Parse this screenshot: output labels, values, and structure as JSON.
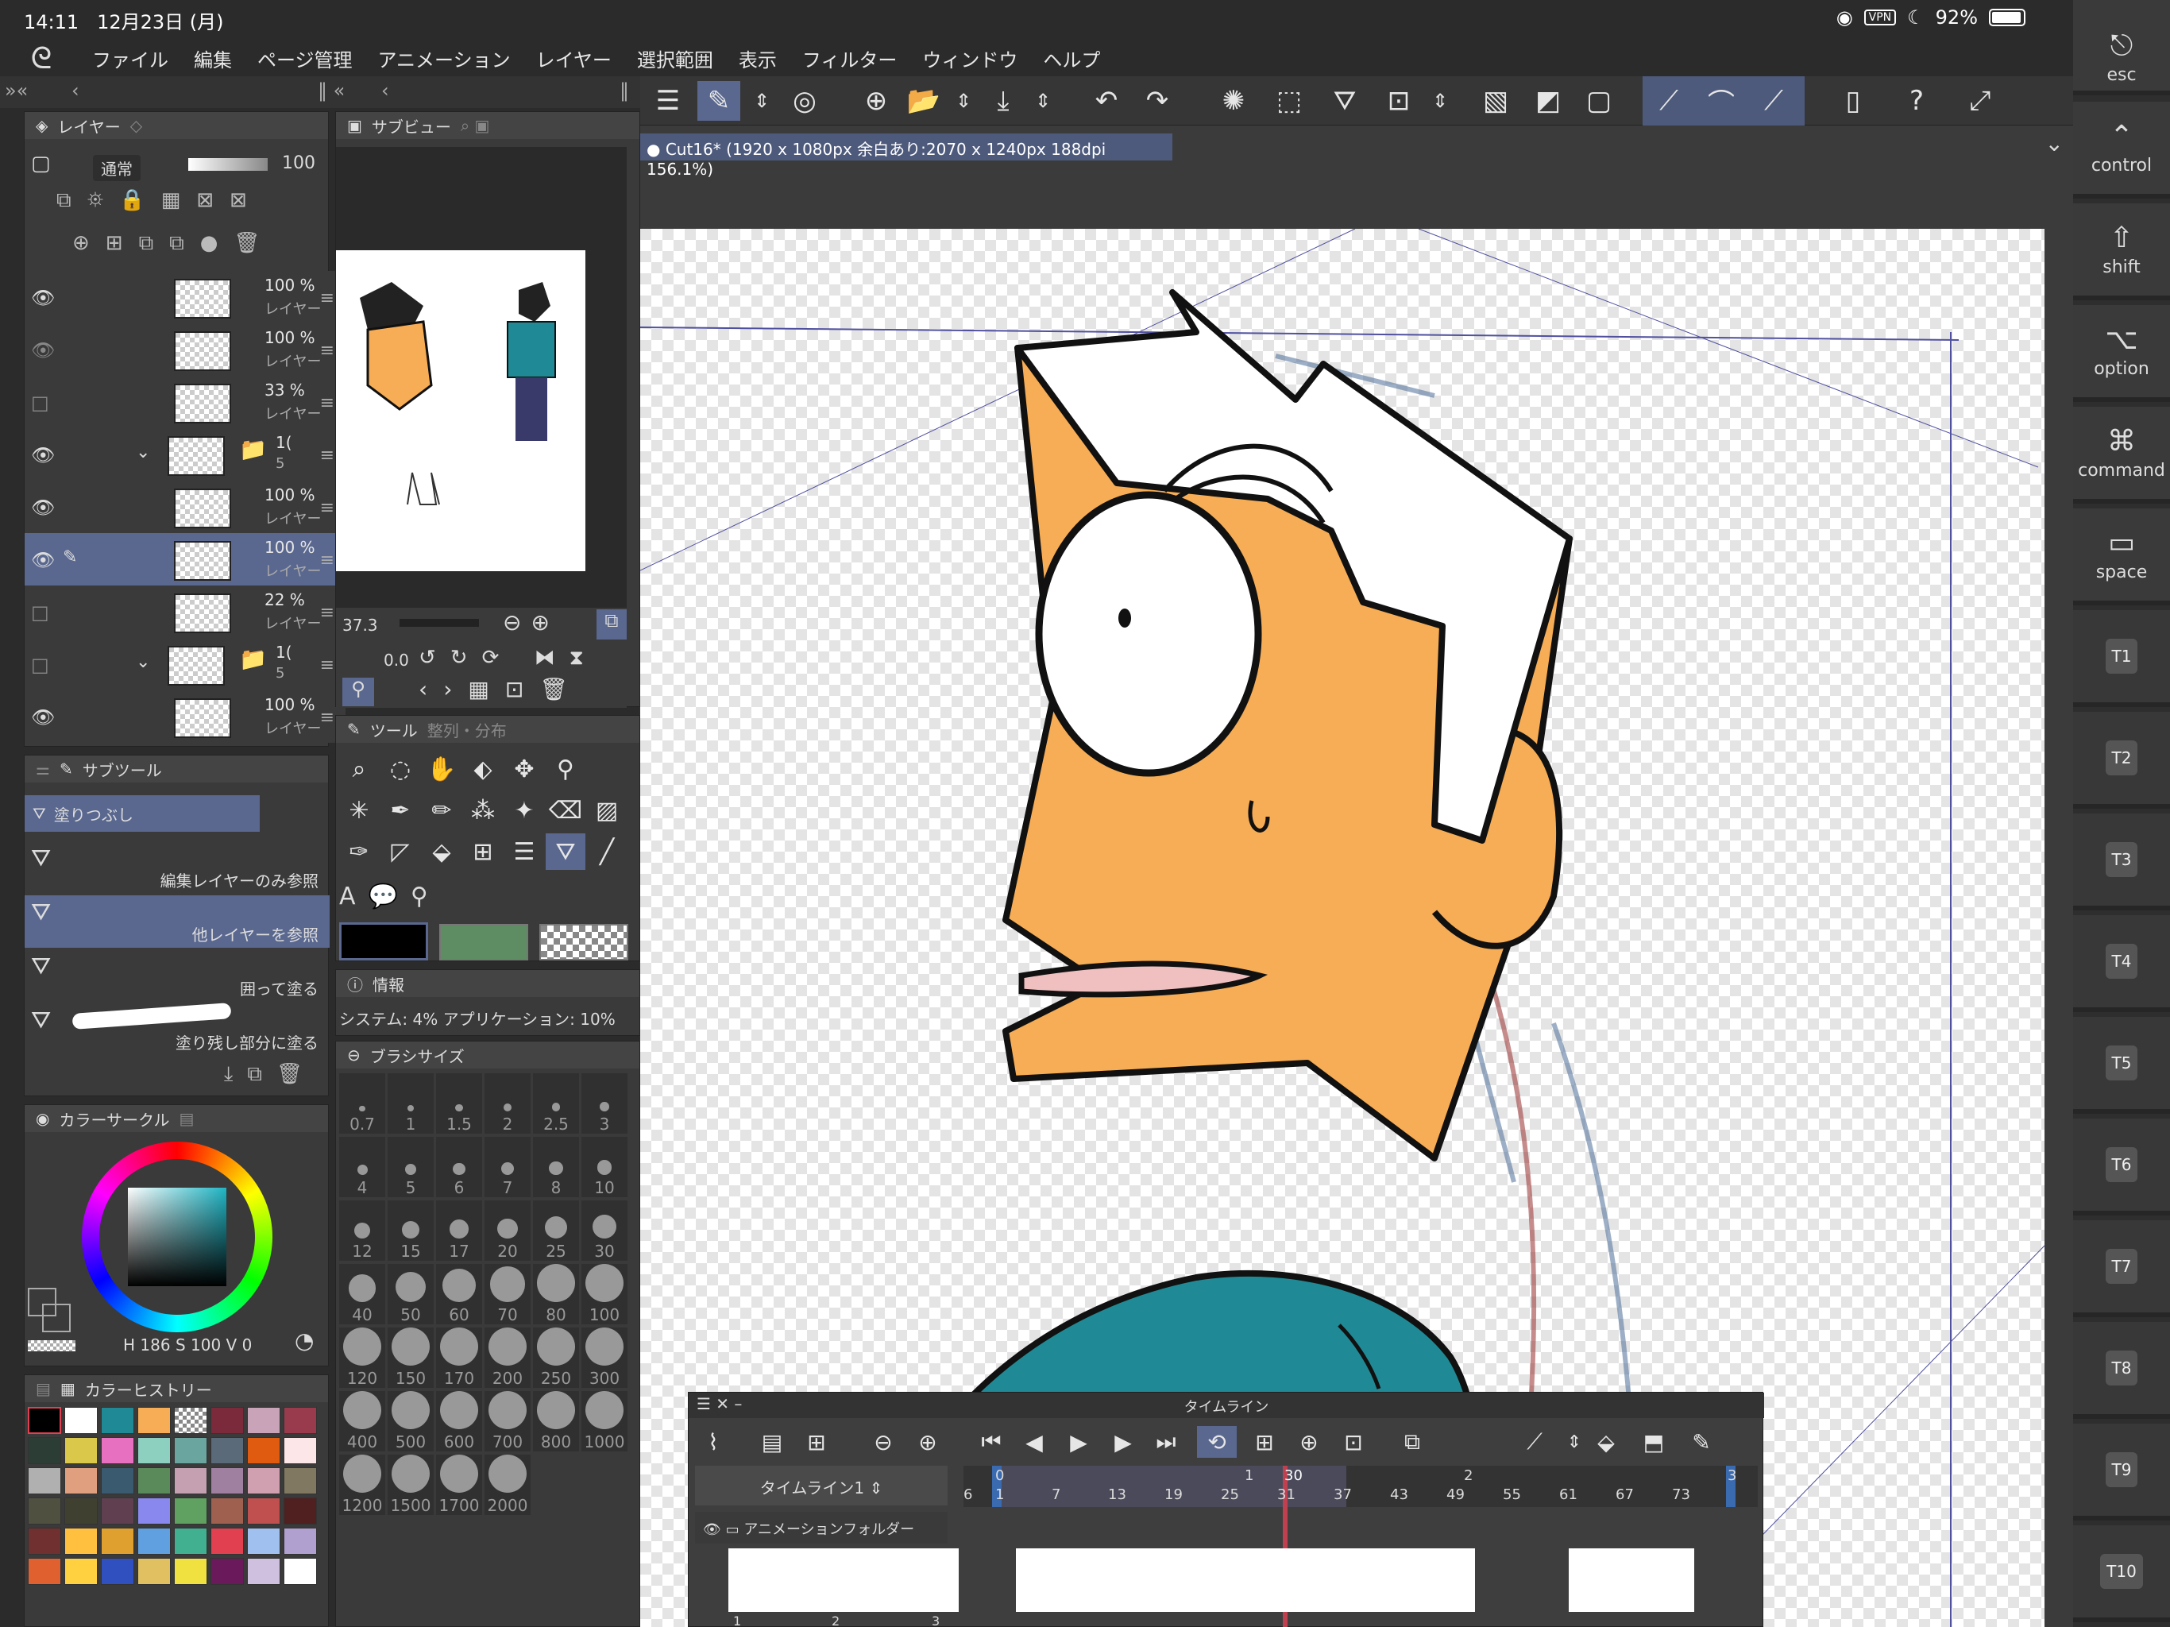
{
  "status": {
    "time": "14:11",
    "date": "12月23日 (月)",
    "vpn": "VPN",
    "battery": "92%"
  },
  "menu": [
    "ファイル",
    "編集",
    "ページ管理",
    "アニメーション",
    "レイヤー",
    "選択範囲",
    "表示",
    "フィルター",
    "ウィンドウ",
    "ヘルプ"
  ],
  "layer_panel": {
    "tab_label": "レイヤー",
    "blend_mode": "通常",
    "opacity": "100",
    "rows": [
      {
        "pct": "100 %",
        "name": "レイヤー"
      },
      {
        "pct": "100 %",
        "name": "レイヤー"
      },
      {
        "pct": "33 %",
        "name": "レイヤー"
      },
      {
        "pct": "1(",
        "name": "5"
      },
      {
        "pct": "100 %",
        "name": "レイヤー"
      },
      {
        "pct": "100 %",
        "name": "レイヤー"
      },
      {
        "pct": "22 %",
        "name": "レイヤー"
      },
      {
        "pct": "1(",
        "name": "5"
      },
      {
        "pct": "100 %",
        "name": "レイヤー"
      }
    ]
  },
  "subview": {
    "tab_label": "サブビュー",
    "zoom": "37.3",
    "angle": "0.0"
  },
  "subtool": {
    "tab_label": "サブツール",
    "selected_tool": "塗りつぶし",
    "items": [
      "編集レイヤーのみ参照",
      "他レイヤーを参照",
      "囲って塗る",
      "塗り残し部分に塗る"
    ]
  },
  "tool_panel": {
    "tab_label": "ツール",
    "tab2_label": "整列・分布"
  },
  "info_panel": {
    "tab_label": "情報",
    "text": "システム: 4%  アプリケーション: 10%"
  },
  "brush_size": {
    "tab_label": "ブラシサイズ",
    "sizes": [
      "0.7",
      "1",
      "1.5",
      "2",
      "2.5",
      "3",
      "4",
      "5",
      "6",
      "7",
      "8",
      "10",
      "12",
      "15",
      "17",
      "20",
      "25",
      "30",
      "40",
      "50",
      "60",
      "70",
      "80",
      "100",
      "120",
      "150",
      "170",
      "200",
      "250",
      "300",
      "400",
      "500",
      "600",
      "700",
      "800",
      "1000",
      "1200",
      "1500",
      "1700",
      "2000"
    ]
  },
  "color_circle": {
    "tab_label": "カラーサークル",
    "h": "186",
    "s": "100",
    "v": "0",
    "main_color": "#000000",
    "sub_color": "#5e8c63"
  },
  "color_history": {
    "tab_label": "カラーヒストリー",
    "swatches": [
      "#000000",
      "#ffffff",
      "#1f8a95",
      "#f7ad55",
      "checker",
      "#7a2a3a",
      "#c9a3b8",
      "#9a3b4d",
      "#2b3d35",
      "#d9c84a",
      "#e870c0",
      "#8ed0c0",
      "#6aa5a0",
      "#5a6a78",
      "#e05a10",
      "#fde6e8",
      "#b0b0b0",
      "#e0a080",
      "#3a5a70",
      "#5a8a5a",
      "#c4a0b0",
      "#a080a0",
      "#d0a0b0",
      "#807860",
      "#505040",
      "#404030",
      "#604050",
      "#8888ee",
      "#60a060",
      "#a06050",
      "#c05050",
      "#502020",
      "#703030",
      "#ffc040",
      "#e0a030",
      "#60a0e0",
      "#40b090",
      "#e04050",
      "#a0c0f0",
      "#b0a0d0",
      "#e06030",
      "#ffd040",
      "#3050c0",
      "#e0c060",
      "#f0e040",
      "#6a1a5a",
      "#d0c0e0",
      "#ffffff"
    ]
  },
  "doc_tab": {
    "title": "Cut16* (1920 x 1080px 余白あり:2070 x 1240px 188dpi 156.1%)"
  },
  "timeline": {
    "title": "タイムライン",
    "name": "タイムライン1",
    "folder": "アニメーションフォルダー",
    "frame_numbers": [
      "6",
      "1",
      "7",
      "13",
      "19",
      "25",
      "31",
      "37",
      "43",
      "49",
      "55",
      "61",
      "67",
      "73"
    ],
    "second_markers": [
      "0",
      "1",
      "30",
      "2",
      "3"
    ],
    "thumb_numbers": [
      "1",
      "2",
      "3"
    ]
  },
  "keys": [
    {
      "sym": "⎋",
      "label": "esc"
    },
    {
      "sym": "⌃",
      "label": "control"
    },
    {
      "sym": "⇧",
      "label": "shift"
    },
    {
      "sym": "⌥",
      "label": "option"
    },
    {
      "sym": "⌘",
      "label": "command"
    },
    {
      "sym": "▭",
      "label": "space"
    }
  ],
  "tkeys": [
    "T1",
    "T2",
    "T3",
    "T4",
    "T5",
    "T6",
    "T7",
    "T8",
    "T9",
    "T10"
  ],
  "colors": {
    "accent": "#5a6890",
    "skin": "#f7ad55",
    "shirt": "#1f8a95",
    "hair": "#ffffff"
  }
}
